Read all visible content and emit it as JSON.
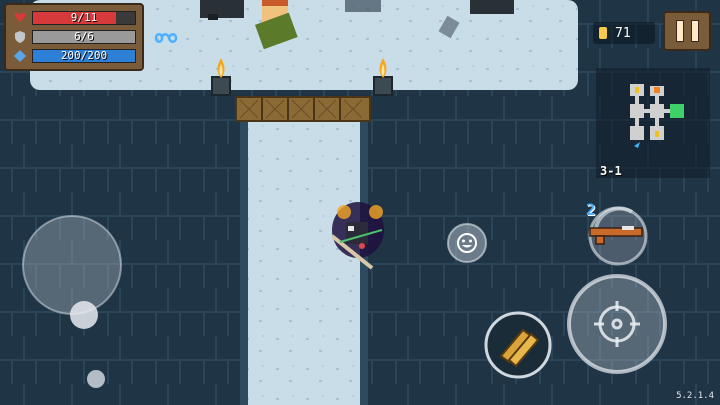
{
  "hud": {
    "health": {
      "text": "9/11",
      "current": 9,
      "max": 11,
      "color": "#d63a3a",
      "icon": "heart-icon"
    },
    "armor": {
      "text": "6/6",
      "current": 6,
      "max": 6,
      "color": "#9a9a9a",
      "icon": "shield-icon"
    },
    "energy": {
      "text": "200/200",
      "current": 200,
      "max": 200,
      "color": "#2e7fd6",
      "icon": "diamond-icon"
    },
    "buff_icon": "infinity-icon"
  },
  "coins": {
    "icon": "coin-icon",
    "value": "71",
    "color": "#f6c94a"
  },
  "pause": {
    "icon": "pause-icon"
  },
  "minimap": {
    "level": "3-1"
  },
  "weapon": {
    "ammo_cost": "2",
    "icon": "rifle-icon",
    "swap_icon": "swap-arrows-icon"
  },
  "buttons": {
    "emote_icon": "smiley-icon",
    "skill_icon": "dual-pistols-icon",
    "attack_icon": "crosshair-icon",
    "joystick": "movement-joystick"
  },
  "version": "5.2.1.4",
  "colors": {
    "floor": "#c8dce9",
    "wall": "#1f3445",
    "bridge": "#8a6a35",
    "hud_frame": "#7a5b3a"
  }
}
